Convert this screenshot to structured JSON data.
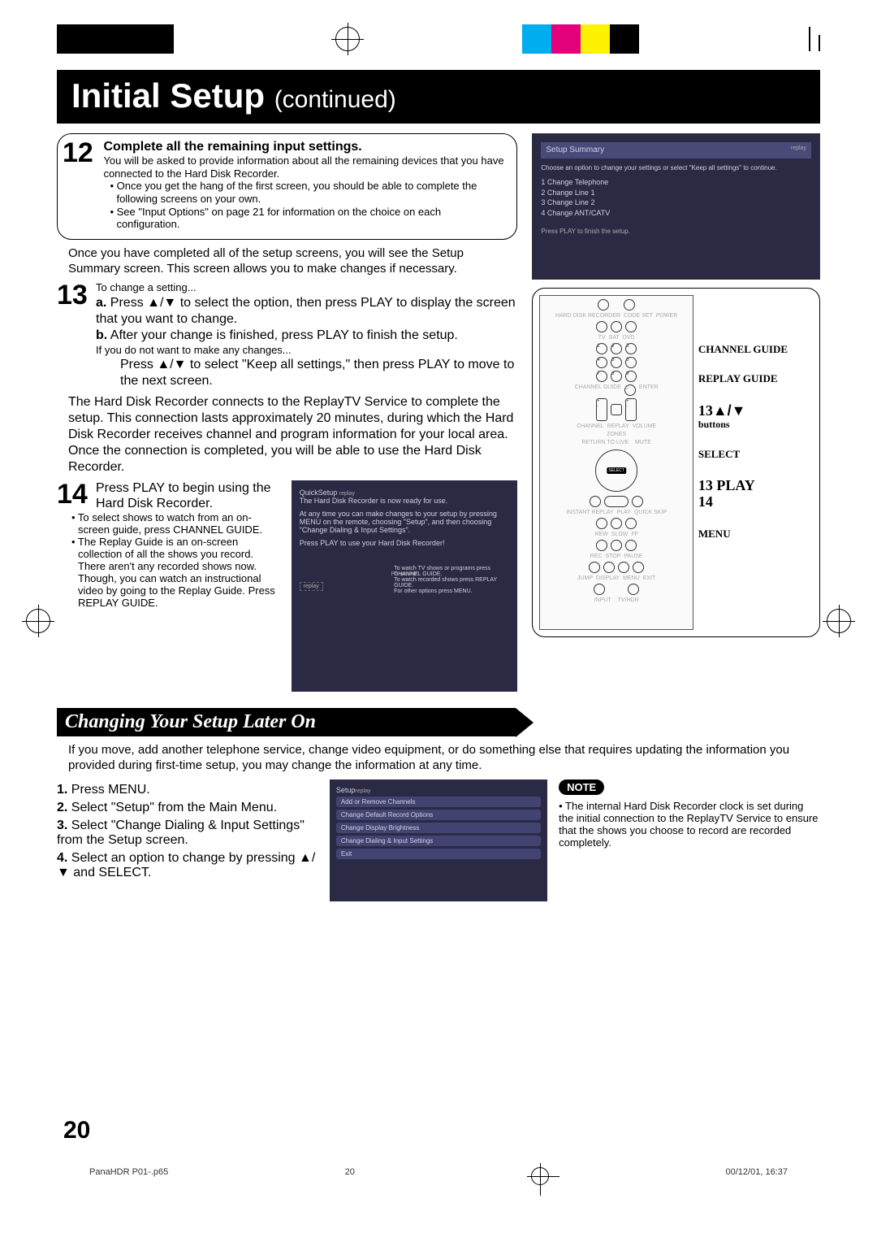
{
  "header": {
    "title": "Initial Setup",
    "continued": "(continued)"
  },
  "step12": {
    "num": "12",
    "title": "Complete all the remaining input settings.",
    "line1": "You will be asked to provide information about all the remaining devices that you have connected to the Hard Disk Recorder.",
    "bullet1": "• Once you get the hang of the first screen, you should be able to complete the following screens on your own.",
    "bullet2": "• See \"Input Options\" on page 21 for information on the choice on each configuration."
  },
  "after12": "Once you have completed all of the setup screens, you will see the Setup Summary screen. This screen allows you to make changes if necessary.",
  "summary_ss": {
    "title": "Setup Summary",
    "logo": "replay",
    "sub": "Choose an option to change your settings or select \"Keep all settings\" to continue.",
    "items": [
      "1  Change Telephone",
      "2  Change Line 1",
      "3  Change Line 2",
      "4  Change ANT/CATV"
    ],
    "footer": "Press PLAY to finish the setup."
  },
  "step13": {
    "num": "13",
    "intro": "To change a setting...",
    "a": "Press ▲/▼ to select the option, then press PLAY to display the screen that you want to change.",
    "a_prefix": "a.",
    "b": "After your change is finished, press PLAY to finish the setup.",
    "b_prefix": "b.",
    "nochange_intro": "If you do not want to make any changes...",
    "nochange": "Press ▲/▼ to select \"Keep all settings,\" then press PLAY to move to the next screen."
  },
  "connect_para": "The Hard Disk Recorder connects to the ReplayTV Service to complete the setup. This connection lasts approximately 20 minutes, during which the Hard Disk Recorder receives channel and program information for your local area. Once the connection is completed, you will be able to use the Hard Disk Recorder.",
  "step14": {
    "num": "14",
    "line1": "Press PLAY to begin using the Hard Disk Recorder.",
    "bullet1": "• To select shows to watch from an on-screen guide, press CHANNEL GUIDE.",
    "bullet2": "• The Replay Guide is an on-screen collection of all the shows you record. There aren't any recorded shows now. Though, you can watch an instructional video by going to the Replay Guide. Press REPLAY GUIDE."
  },
  "quick_ss": {
    "title": "QuickSetup",
    "logo": "replay",
    "l1": "The Hard Disk Recorder is now ready for use.",
    "l2": "At any time you can make changes to your setup by pressing MENU on the remote, choosing \"Setup\", and then choosing \"Change Dialing & Input Settings\".",
    "l3": "Press PLAY to use your Hard Disk Recorder!",
    "brand": "Panasonic",
    "f1": "To watch TV shows or programs press CHANNEL GUIDE.",
    "f2": "To watch recorded shows press REPLAY GUIDE.",
    "f3": "For other options press MENU."
  },
  "remote_labels": {
    "l1": "CHANNEL GUIDE",
    "l2": "REPLAY GUIDE",
    "l3_num": "13",
    "l3_sym": "▲/▼",
    "l3_sub": "buttons",
    "l4": "SELECT",
    "l5": "13 PLAY",
    "l6": "14",
    "l7": "MENU"
  },
  "remote_tiny": {
    "t1": "HARD DISK RECORDER",
    "t2": "CODE SET",
    "t3": "POWER",
    "t4": "TV",
    "t5": "SAT",
    "t6": "DVD",
    "t7": "CHANNEL GUIDE",
    "t8": "ENTER",
    "t9": "CHANNEL",
    "t10": "REPLAY",
    "t11": "VOLUME",
    "t12": "ZONES",
    "t13": "RETURN TO LIVE",
    "t14": "MUTE",
    "t15": "SELECT",
    "t16": "INSTANT REPLAY",
    "t17": "PLAY",
    "t18": "QUICK SKIP",
    "t19": "REW",
    "t20": "SLOW",
    "t21": "FF",
    "t22": "REC",
    "t23": "STOP",
    "t24": "PAUSE",
    "t25": "JUMP",
    "t26": "DISPLAY",
    "t27": "MENU",
    "t28": "EXIT",
    "t29": "INPUT",
    "t30": "TV/HDR"
  },
  "section2": {
    "title": "Changing Your Setup Later On",
    "intro": "If you move, add another telephone service, change video equipment, or do something else that requires updating the information you provided during first-time setup, you may change the information at any time.",
    "i1_num": "1.",
    "i1": "Press MENU.",
    "i2_num": "2.",
    "i2": "Select \"Setup\" from the Main Menu.",
    "i3_num": "3.",
    "i3": "Select \"Change Dialing & Input Settings\" from the Setup screen.",
    "i4_num": "4.",
    "i4": "Select an option to change by pressing ▲/▼ and SELECT."
  },
  "setup_ss": {
    "title": "Setup",
    "logo": "replay",
    "items": [
      "Add or Remove Channels",
      "Change Default Record Options",
      "Change Display Brightness",
      "Change Dialing & Input Settings",
      "Exit"
    ]
  },
  "note": {
    "label": "NOTE",
    "text": "• The internal Hard Disk Recorder clock is set during the initial connection to the ReplayTV Service to ensure that the shows you choose to record are recorded completely."
  },
  "page_num": "20",
  "footer": {
    "file": "PanaHDR P01-.p65",
    "pg": "20",
    "date": "00/12/01, 16:37"
  },
  "color_blocks": [
    "#000000",
    "#000000",
    "#000000",
    "#000000",
    "#00AEEF",
    "#E3007B",
    "#FFF200",
    "#000000"
  ]
}
